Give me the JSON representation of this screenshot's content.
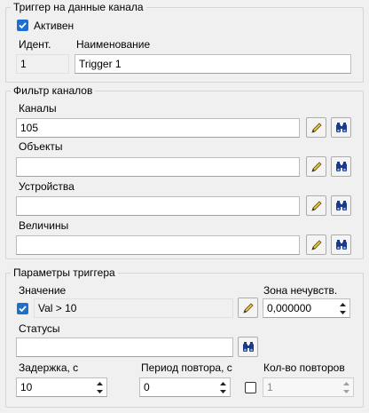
{
  "trigger_group": {
    "title": "Триггер на данные канала",
    "active_label": "Активен",
    "active_checked": true,
    "id_label": "Идент.",
    "id_value": "1",
    "name_label": "Наименование",
    "name_value": "Trigger 1"
  },
  "filter_group": {
    "title": "Фильтр каналов",
    "rows": [
      {
        "label": "Каналы",
        "value": "105"
      },
      {
        "label": "Объекты",
        "value": ""
      },
      {
        "label": "Устройства",
        "value": ""
      },
      {
        "label": "Величины",
        "value": ""
      }
    ]
  },
  "params_group": {
    "title": "Параметры триггера",
    "value_label": "Значение",
    "value_checked": true,
    "value_expr": "Val > 10",
    "deadband_label": "Зона нечувств.",
    "deadband_value": "0,000000",
    "statuses_label": "Статусы",
    "statuses_value": "",
    "delay_label": "Задержка, с",
    "delay_value": "10",
    "period_label": "Период повтора, с",
    "period_value": "0",
    "repeat_label": "Кол-во повторов",
    "repeat_checked": false,
    "repeat_value": "1"
  },
  "icons": {
    "edit": "pencil-icon",
    "search": "binoculars-icon",
    "spin_up": "chevron-up-icon",
    "spin_down": "chevron-down-icon",
    "check": "checkmark-icon"
  },
  "colors": {
    "accent": "#1f6fd1",
    "background": "#f0f0f0",
    "icon_blue": "#1a3a8a",
    "pencil_yellow": "#e8c63a"
  }
}
